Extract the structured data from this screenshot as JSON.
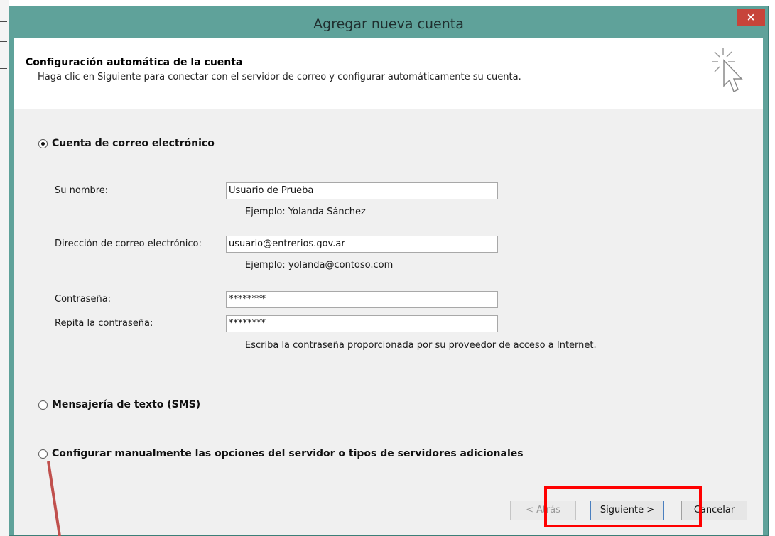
{
  "window": {
    "title": "Agregar nueva cuenta",
    "close_label": "×"
  },
  "header": {
    "title": "Configuración automática de la cuenta",
    "subtitle": "Haga clic en Siguiente para conectar con el servidor de correo y configurar automáticamente su cuenta.",
    "icon": "wizard-cursor-icon"
  },
  "options": {
    "email_account": {
      "label": "Cuenta de correo electrónico",
      "selected": true
    },
    "sms": {
      "label": "Mensajería de texto (SMS)",
      "selected": false
    },
    "manual": {
      "label": "Configurar manualmente las opciones del servidor o tipos de servidores adicionales",
      "selected": false
    }
  },
  "form": {
    "name_label": "Su nombre:",
    "name_value": "Usuario de Prueba",
    "name_hint": "Ejemplo: Yolanda Sánchez",
    "email_label": "Dirección de correo electrónico:",
    "email_value": "usuario@entrerios.gov.ar",
    "email_hint": "Ejemplo: yolanda@contoso.com",
    "password_label": "Contraseña:",
    "password_value": "********",
    "repeat_label": "Repita la contraseña:",
    "repeat_value": "********",
    "password_hint": "Escriba la contraseña proporcionada por su proveedor de acceso a Internet."
  },
  "buttons": {
    "back": "< Atrás",
    "next": "Siguiente >",
    "cancel": "Cancelar"
  },
  "colors": {
    "window_frame": "#5fa29a",
    "close_button": "#c7443a",
    "annotation_box": "#ff0000",
    "annotation_arrow": "#c0504d"
  }
}
